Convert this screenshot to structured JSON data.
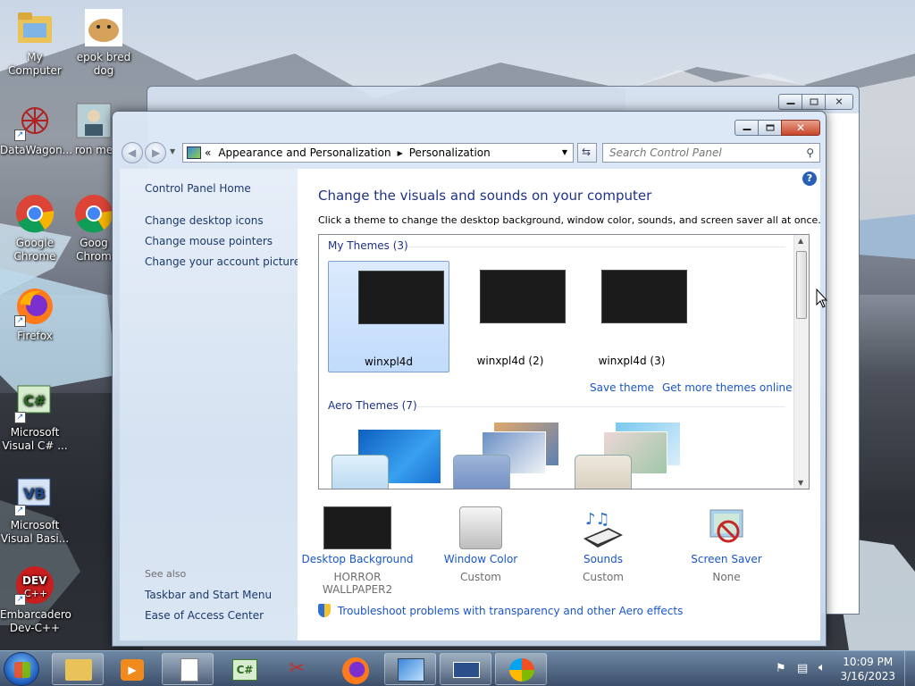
{
  "desktop": {
    "icons": [
      {
        "label": "My Computer",
        "icon": "folder-icon"
      },
      {
        "label": "epok bred dog",
        "icon": "dog-image-icon"
      },
      {
        "label": "DataWagon...",
        "icon": "datawagon-icon"
      },
      {
        "label": "ron me",
        "icon": "person-icon"
      },
      {
        "label": "Google Chrome",
        "icon": "chrome-icon"
      },
      {
        "label": "Goog Chrom",
        "icon": "chrome-icon"
      },
      {
        "label": "Firefox",
        "icon": "firefox-icon"
      },
      {
        "label": "Microsoft Visual C# ...",
        "icon": "visual-csharp-icon"
      },
      {
        "label": "Microsoft Visual Basi...",
        "icon": "visual-basic-icon"
      },
      {
        "label": "Embarcadero Dev-C++",
        "icon": "devcpp-icon"
      }
    ]
  },
  "window": {
    "address": {
      "separator": "«",
      "crumbs": [
        "Appearance and Personalization",
        "Personalization"
      ]
    },
    "search_placeholder": "Search Control Panel",
    "left_pane": {
      "home": "Control Panel Home",
      "links": [
        "Change desktop icons",
        "Change mouse pointers",
        "Change your account picture"
      ],
      "see_also_title": "See also",
      "see_also": [
        "Taskbar and Start Menu",
        "Ease of Access Center"
      ]
    },
    "main": {
      "title": "Change the visuals and sounds on your computer",
      "subtitle": "Click a theme to change the desktop background, window color, sounds, and screen saver all at once.",
      "my_themes_header": "My Themes (3)",
      "my_themes": [
        "winxpl4d",
        "winxpl4d (2)",
        "winxpl4d (3)"
      ],
      "save_theme": "Save theme",
      "get_more": "Get more themes online",
      "aero_header": "Aero Themes (7)"
    },
    "bottom": [
      {
        "caption": "Desktop Background",
        "value": "HORROR WALLPAPER2",
        "icon": "wallpaper-icon"
      },
      {
        "caption": "Window Color",
        "value": "Custom",
        "icon": "window-color-icon"
      },
      {
        "caption": "Sounds",
        "value": "Custom",
        "icon": "sounds-icon"
      },
      {
        "caption": "Screen Saver",
        "value": "None",
        "icon": "screen-saver-icon"
      }
    ],
    "troubleshoot": "Troubleshoot problems with transparency and other Aero effects"
  },
  "taskbar": {
    "time": "10:09 PM",
    "date": "3/16/2023"
  },
  "colors": {
    "link": "#1a56c8",
    "heading": "#1e3287",
    "selection": "#c1dbfc"
  }
}
